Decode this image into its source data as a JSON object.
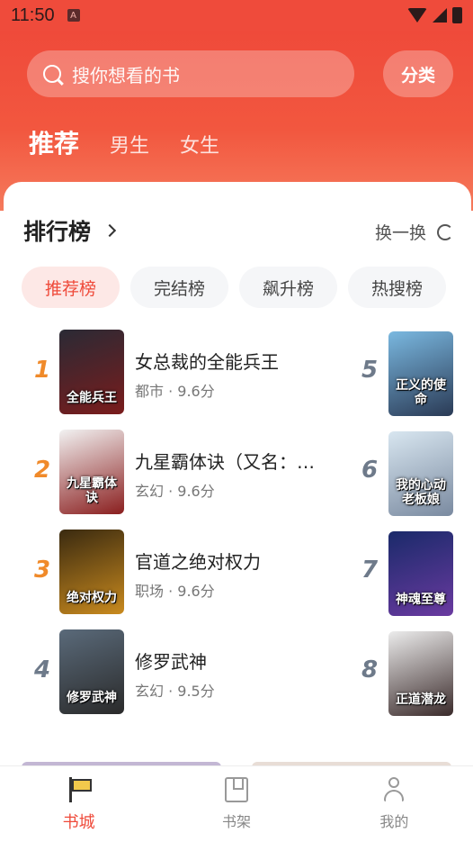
{
  "status_bar": {
    "time": "11:50",
    "notification_badge": "A"
  },
  "header": {
    "search_placeholder": "搜你想看的书",
    "category_label": "分类",
    "tabs": [
      {
        "label": "推荐",
        "active": true
      },
      {
        "label": "男生",
        "active": false
      },
      {
        "label": "女生",
        "active": false
      }
    ]
  },
  "ranking": {
    "title": "排行榜",
    "swap_label": "换一换",
    "chips": [
      {
        "label": "推荐榜",
        "active": true
      },
      {
        "label": "完结榜",
        "active": false
      },
      {
        "label": "飙升榜",
        "active": false
      },
      {
        "label": "热搜榜",
        "active": false
      }
    ],
    "left_items": [
      {
        "rank": "1",
        "title": "女总裁的全能兵王",
        "meta": "都市 · 9.6分",
        "cover_text": "全能兵王",
        "rank_color": "#f08a2a",
        "cover_colors": [
          "#2a2a35",
          "#7a1c1c"
        ]
      },
      {
        "rank": "2",
        "title": "九星霸体诀（又名：…",
        "meta": "玄幻 · 9.6分",
        "cover_text": "九星霸体诀",
        "rank_color": "#f08a2a",
        "cover_colors": [
          "#f2f2f2",
          "#8a1e1e"
        ]
      },
      {
        "rank": "3",
        "title": "官道之绝对权力",
        "meta": "职场 · 9.6分",
        "cover_text": "绝对权力",
        "rank_color": "#f08a2a",
        "cover_colors": [
          "#3a2a10",
          "#c98a1e"
        ]
      },
      {
        "rank": "4",
        "title": "修罗武神",
        "meta": "玄幻 · 9.5分",
        "cover_text": "修罗武神",
        "rank_color": "#6e7a8a",
        "cover_colors": [
          "#5a6a7a",
          "#2a2a2a"
        ]
      }
    ],
    "right_items": [
      {
        "rank": "5",
        "cover_text": "正义的使命",
        "cover_colors": [
          "#7ab8e0",
          "#2a3a55"
        ]
      },
      {
        "rank": "6",
        "cover_text": "我的心动老板娘",
        "cover_colors": [
          "#d8e6f0",
          "#7a8aa0"
        ]
      },
      {
        "rank": "7",
        "cover_text": "神魂至尊",
        "cover_colors": [
          "#1a2a6a",
          "#6a3aa0"
        ]
      },
      {
        "rank": "8",
        "cover_text": "正道潜龙",
        "cover_colors": [
          "#ececec",
          "#3a2a2a"
        ]
      }
    ]
  },
  "bottom_nav": [
    {
      "label": "书城",
      "icon": "flag-icon",
      "active": true
    },
    {
      "label": "书架",
      "icon": "book-icon",
      "active": false
    },
    {
      "label": "我的",
      "icon": "person-icon",
      "active": false
    }
  ],
  "colors": {
    "accent": "#ef4a3a",
    "rank_top": "#f08a2a",
    "rank_other": "#6e7a8a"
  }
}
